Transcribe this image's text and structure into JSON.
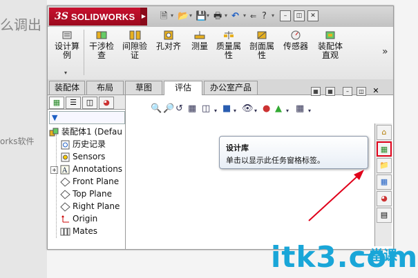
{
  "background": {
    "title": "么调出",
    "text": "orks软件"
  },
  "app": {
    "logo_ds": "3S",
    "logo_name": "SOLIDWORKS"
  },
  "ribbon": {
    "items": [
      {
        "label": "设计算\n例"
      },
      {
        "label": "干涉检\n查"
      },
      {
        "label": "间隙验\n证"
      },
      {
        "label": "孔对齐"
      },
      {
        "label": "测量"
      },
      {
        "label": "质量属\n性"
      },
      {
        "label": "剖面属\n性"
      },
      {
        "label": "传感器"
      },
      {
        "label": "装配体\n直观"
      }
    ],
    "more": "»"
  },
  "tabs": [
    {
      "label": "装配体"
    },
    {
      "label": "布局"
    },
    {
      "label": "草图"
    },
    {
      "label": "评估",
      "active": true
    },
    {
      "label": "办公室产品"
    }
  ],
  "tree": {
    "items": [
      {
        "label": "装配体1 (Defau",
        "icon": "assembly-icon"
      },
      {
        "label": "历史记录",
        "icon": "history-icon"
      },
      {
        "label": "Sensors",
        "icon": "sensors-icon"
      },
      {
        "label": "Annotations",
        "icon": "annotations-icon",
        "expandable": true
      },
      {
        "label": "Front Plane",
        "icon": "plane-icon"
      },
      {
        "label": "Top Plane",
        "icon": "plane-icon"
      },
      {
        "label": "Right Plane",
        "icon": "plane-icon"
      },
      {
        "label": "Origin",
        "icon": "origin-icon"
      },
      {
        "label": "Mates",
        "icon": "mates-icon"
      }
    ]
  },
  "tooltip": {
    "title": "设计库",
    "body": "单击以显示此任务窗格标签。"
  },
  "watermark": {
    "main": "itk3.com",
    "sub": "一堂课"
  },
  "colors": {
    "brand_red": "#c8102e",
    "arrow_red": "#e0001a",
    "watermark_blue": "#19a6d8"
  }
}
